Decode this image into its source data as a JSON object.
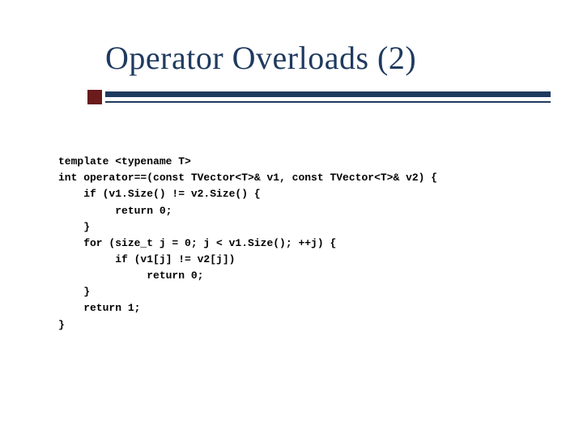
{
  "title": "Operator Overloads (2)",
  "code": {
    "lines": [
      "template <typename T>",
      "int operator==(const TVector<T>& v1, const TVector<T>& v2) {",
      "    if (v1.Size() != v2.Size() {",
      "         return 0;",
      "    }",
      "    for (size_t j = 0; j < v1.Size(); ++j) {",
      "         if (v1[j] != v2[j])",
      "              return 0;",
      "    }",
      "    return 1;",
      "}"
    ]
  }
}
